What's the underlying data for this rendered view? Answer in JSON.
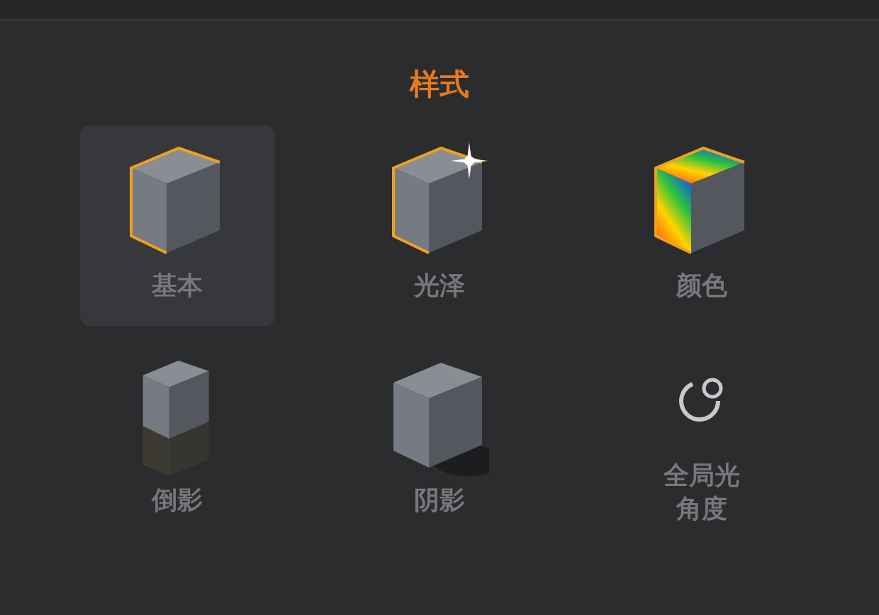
{
  "title": "样式",
  "options": [
    {
      "label": "基本",
      "kind": "basic",
      "selected": true
    },
    {
      "label": "光泽",
      "kind": "gloss",
      "selected": false
    },
    {
      "label": "颜色",
      "kind": "color",
      "selected": false
    },
    {
      "label": "倒影",
      "kind": "reflection",
      "selected": false
    },
    {
      "label": "阴影",
      "kind": "shadow",
      "selected": false
    },
    {
      "label": "全局光角度",
      "kind": "light",
      "selected": false
    }
  ]
}
